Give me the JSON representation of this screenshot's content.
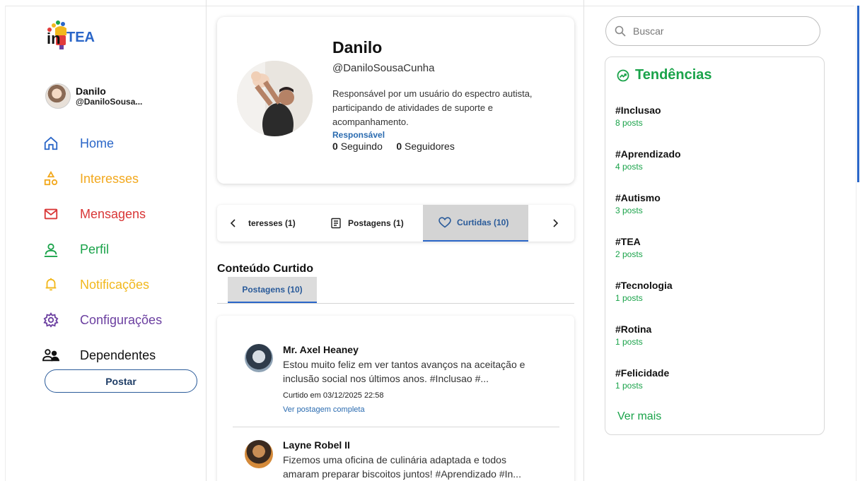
{
  "brand": {
    "name": "inTEA"
  },
  "user": {
    "name": "Danilo",
    "handle": "@DaniloSousa..."
  },
  "nav": {
    "items": [
      {
        "label": "Home",
        "icon": "home-icon",
        "color": "#2a66c8"
      },
      {
        "label": "Interesses",
        "icon": "shapes-icon",
        "color": "#f2a81d"
      },
      {
        "label": "Mensagens",
        "icon": "mail-icon",
        "color": "#d93636"
      },
      {
        "label": "Perfil",
        "icon": "user-icon",
        "color": "#1aa34a"
      },
      {
        "label": "Notificações",
        "icon": "bell-icon",
        "color": "#f2b81d"
      },
      {
        "label": "Configurações",
        "icon": "gear-icon",
        "color": "#6b3fa0"
      },
      {
        "label": "Dependentes",
        "icon": "users-icon",
        "color": "#111111"
      }
    ],
    "post_button": "Postar"
  },
  "profile": {
    "name": "Danilo",
    "handle": "@DaniloSousaCunha",
    "bio": "Responsável por um usuário do espectro autista, participando de atividades de suporte e acompanhamento.",
    "role": "Responsável",
    "following_count": "0",
    "following_label": "Seguindo",
    "followers_count": "0",
    "followers_label": "Seguidores"
  },
  "tabs": {
    "items": [
      {
        "label": "teresses (1)",
        "icon": ""
      },
      {
        "label": "Postagens (1)",
        "icon": "document-icon"
      },
      {
        "label": "Curtidas (10)",
        "icon": "heart-icon",
        "active": true
      }
    ]
  },
  "liked": {
    "title": "Conteúdo Curtido",
    "subtab": "Postagens (10)",
    "posts": [
      {
        "author": "Mr. Axel Heaney",
        "text": "Estou muito feliz em ver tantos avanços na aceitação e inclusão social nos últimos anos. #Inclusao #...",
        "liked_at": "Curtido em 03/12/2025 22:58",
        "link": "Ver postagem completa"
      },
      {
        "author": "Layne Robel II",
        "text": "Fizemos uma oficina de culinária adaptada e todos amaram preparar biscoitos juntos! #Aprendizado #In..."
      }
    ]
  },
  "search": {
    "placeholder": "Buscar"
  },
  "trends": {
    "title": "Tendências",
    "items": [
      {
        "tag": "#Inclusao",
        "count": "8 posts"
      },
      {
        "tag": "#Aprendizado",
        "count": "4 posts"
      },
      {
        "tag": "#Autismo",
        "count": "3 posts"
      },
      {
        "tag": "#TEA",
        "count": "2 posts"
      },
      {
        "tag": "#Tecnologia",
        "count": "1 posts"
      },
      {
        "tag": "#Rotina",
        "count": "1 posts"
      },
      {
        "tag": "#Felicidade",
        "count": "1 posts"
      }
    ],
    "more": "Ver mais",
    "accent": "#1aa34a"
  }
}
